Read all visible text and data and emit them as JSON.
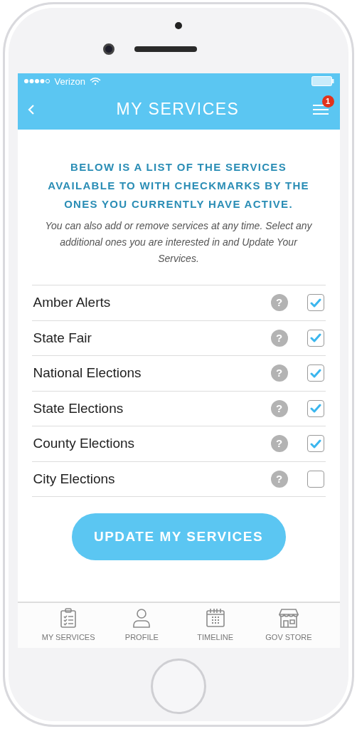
{
  "status_bar": {
    "carrier": "Verizon"
  },
  "header": {
    "title": "MY SERVICES",
    "menu_badge": "1"
  },
  "intro": {
    "heading": "BELOW IS A LIST OF THE SERVICES AVAILABLE TO WITH CHECKMARKS BY THE ONES YOU CURRENTLY HAVE ACTIVE.",
    "text": "You can also add or remove services at any time. Select any additional ones you are interested in and Update Your Services."
  },
  "services": [
    {
      "name": "Amber Alerts",
      "help": "?",
      "checked": true
    },
    {
      "name": "State Fair",
      "help": "?",
      "checked": true
    },
    {
      "name": "National Elections",
      "help": "?",
      "checked": true
    },
    {
      "name": "State Elections",
      "help": "?",
      "checked": true
    },
    {
      "name": "County Elections",
      "help": "?",
      "checked": true
    },
    {
      "name": "City Elections",
      "help": "?",
      "checked": false
    }
  ],
  "update_button": "UPDATE MY SERVICES",
  "tab_bar": [
    {
      "label": "MY SERVICES",
      "kind": "clipboard"
    },
    {
      "label": "PROFILE",
      "kind": "person"
    },
    {
      "label": "TIMELINE",
      "kind": "calendar"
    },
    {
      "label": "GOV STORE",
      "kind": "store"
    }
  ]
}
